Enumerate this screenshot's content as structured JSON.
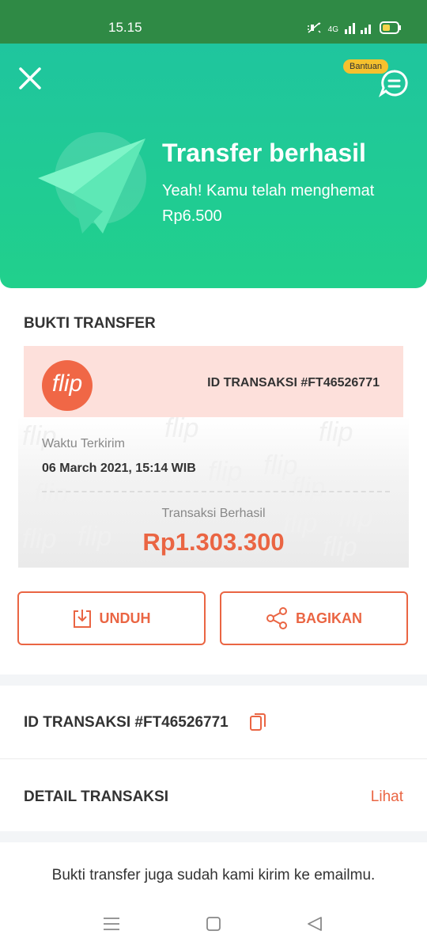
{
  "status_bar": {
    "time": "15.15",
    "network": "4G"
  },
  "header": {
    "help_label": "Bantuan",
    "title": "Transfer berhasil",
    "subtitle": "Yeah! Kamu telah menghemat Rp6.500"
  },
  "receipt": {
    "section_title": "BUKTI TRANSFER",
    "logo_text": "flip",
    "id": "ID TRANSAKSI #FT46526771",
    "time_label": "Waktu Terkirim",
    "time_value": "06 March 2021, 15:14 WIB",
    "status": "Transaksi Berhasil",
    "amount": "Rp1.303.300",
    "watermark": "flip"
  },
  "actions": {
    "download": "UNDUH",
    "share": "BAGIKAN"
  },
  "details": {
    "transaction_id": "ID TRANSAKSI #FT46526771",
    "detail_label": "DETAIL TRANSAKSI",
    "view_link": "Lihat"
  },
  "footer_note": "Bukti transfer juga sudah kami kirim ke emailmu.",
  "colors": {
    "header": "#21d08c",
    "accent": "#ea6543",
    "statusbar": "#2f8a45"
  }
}
